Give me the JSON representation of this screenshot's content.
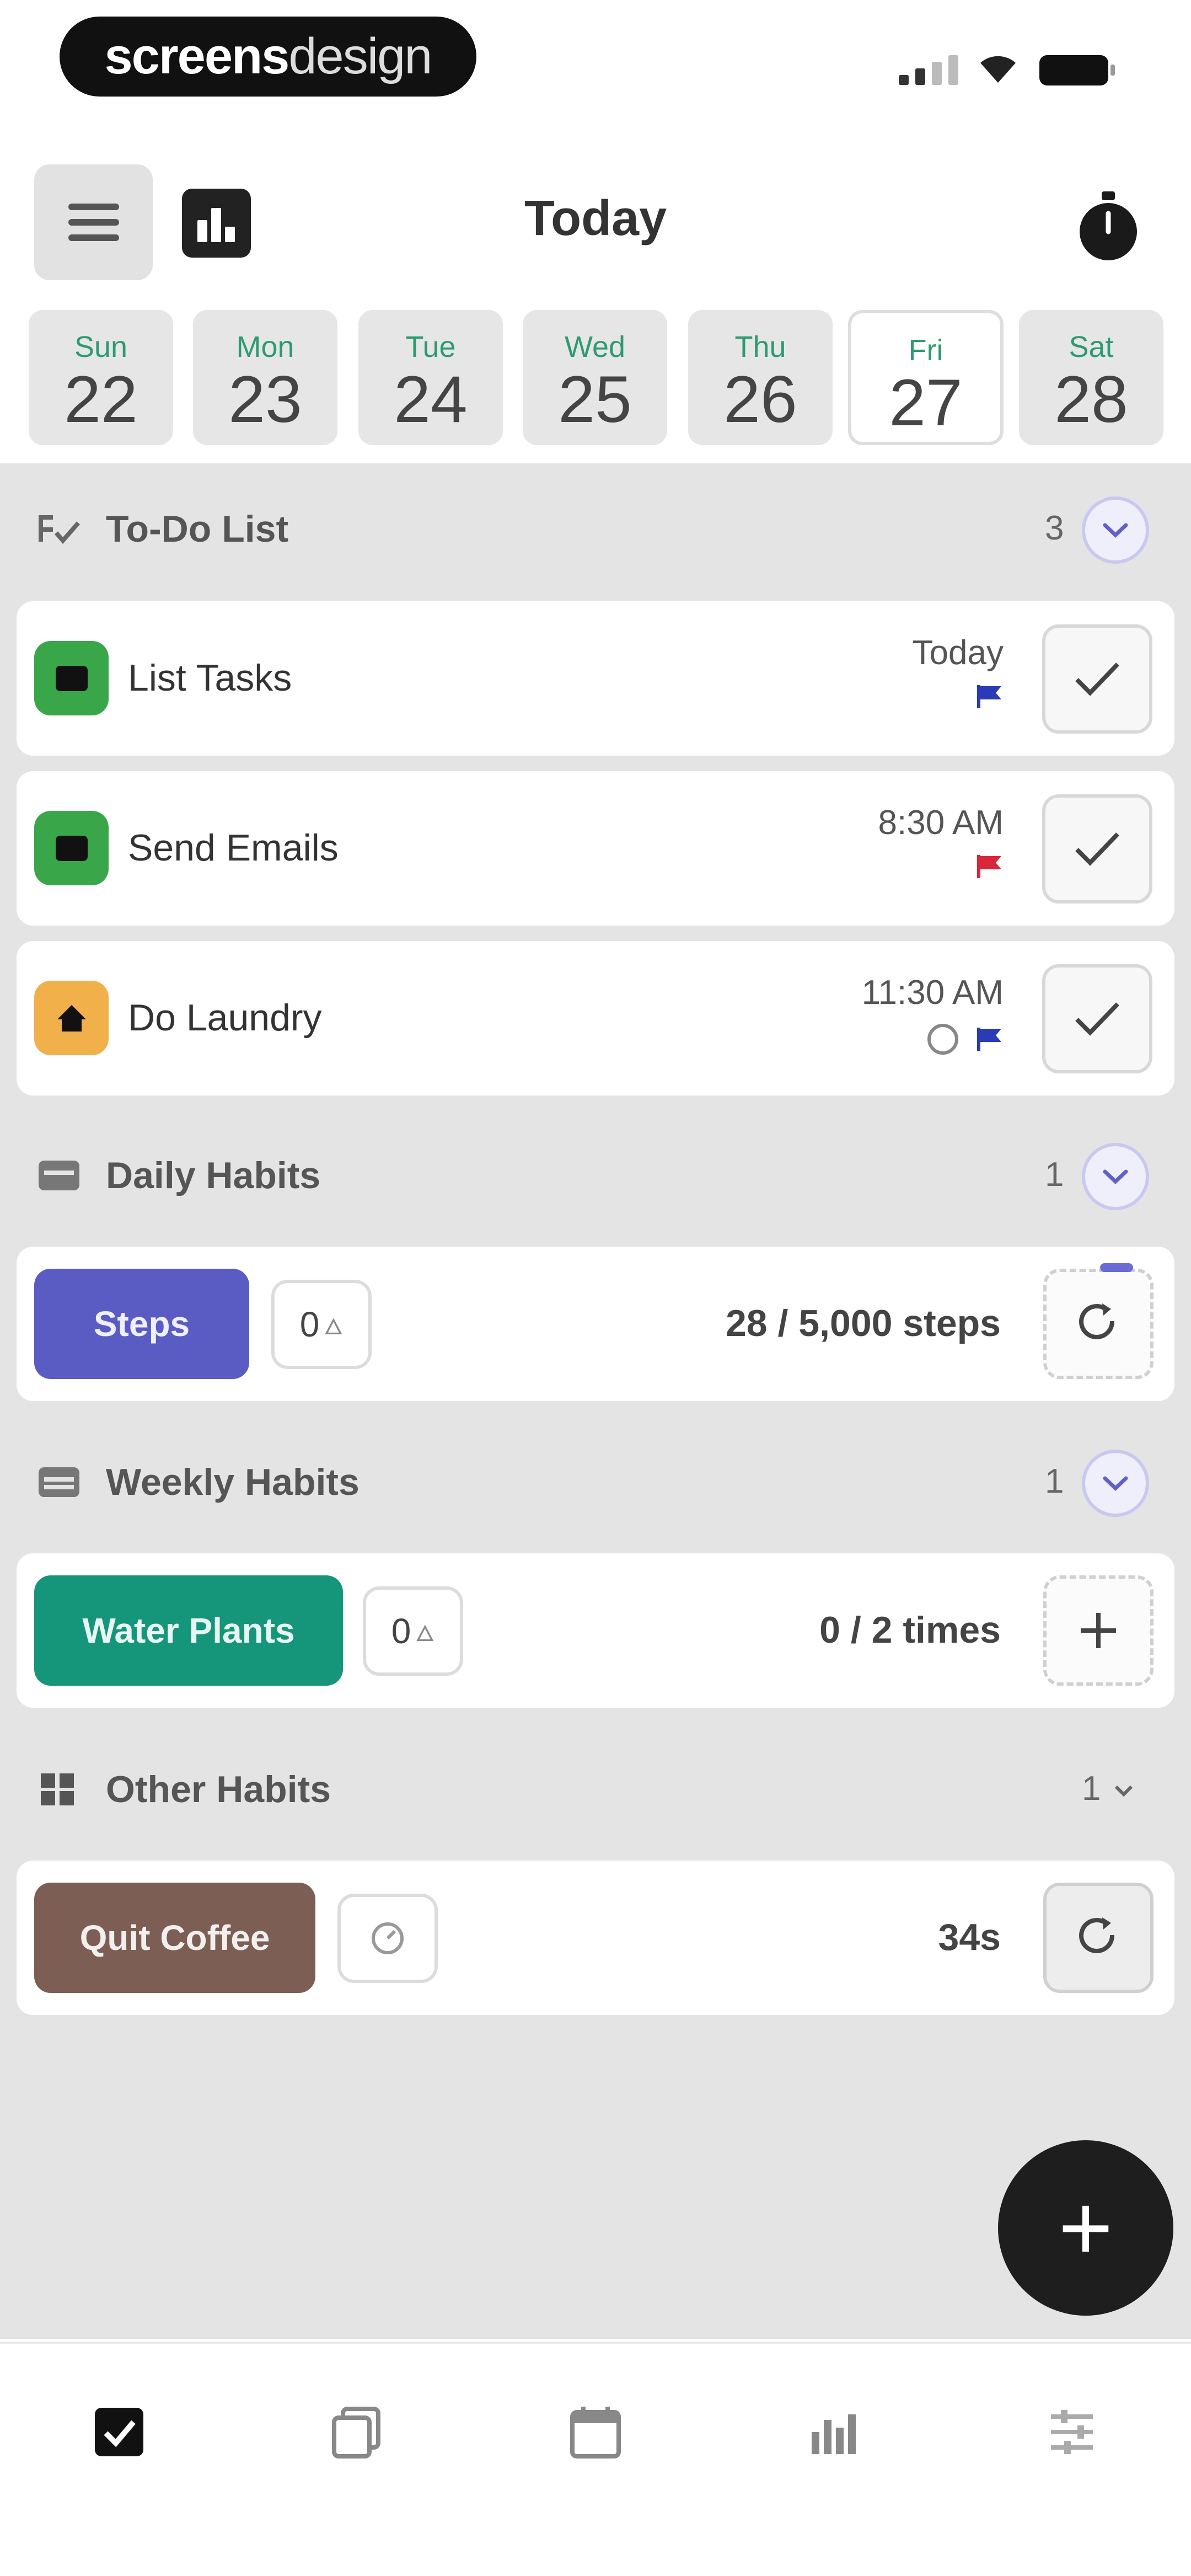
{
  "status_bar": {
    "brand_bold": "screens",
    "brand_light": "design"
  },
  "header": {
    "title": "Today",
    "menu_icon": "hamburger-icon",
    "stats_icon": "bar-chart-icon",
    "timer_icon": "stopwatch-icon"
  },
  "days": [
    {
      "name": "Sun",
      "num": "22"
    },
    {
      "name": "Mon",
      "num": "23"
    },
    {
      "name": "Tue",
      "num": "24"
    },
    {
      "name": "Wed",
      "num": "25"
    },
    {
      "name": "Thu",
      "num": "26"
    },
    {
      "name": "Fri",
      "num": "27",
      "selected": true
    },
    {
      "name": "Sat",
      "num": "28"
    }
  ],
  "todo": {
    "title": "To-Do List",
    "count": "3",
    "items": [
      {
        "title": "List Tasks",
        "time": "Today",
        "icon_color": "#3aa64a",
        "flag_color": "#2a3bb5",
        "icon": "briefcase-icon"
      },
      {
        "title": "Send Emails",
        "time": "8:30 AM",
        "icon_color": "#3aa64a",
        "flag_color": "#d9263a",
        "icon": "briefcase-icon"
      },
      {
        "title": "Do Laundry",
        "time": "11:30 AM",
        "icon_color": "#f2b04b",
        "flag_color": "#2a3bb5",
        "icon": "home-icon",
        "alarm": true
      }
    ]
  },
  "daily": {
    "title": "Daily Habits",
    "count": "1",
    "habit": {
      "name": "Steps",
      "streak": "0",
      "progress": "28 / 5,000 steps",
      "color": "#5b5bc4",
      "progress_fraction": 0.0056
    }
  },
  "weekly": {
    "title": "Weekly Habits",
    "count": "1",
    "habit": {
      "name": "Water Plants",
      "streak": "0",
      "progress": "0 / 2 times",
      "color": "#15957a"
    }
  },
  "other": {
    "title": "Other Habits",
    "count": "1",
    "habit": {
      "name": "Quit Coffee",
      "progress": "34s",
      "color": "#7d5e55"
    }
  },
  "fab": {
    "label": "+"
  },
  "tabs": [
    {
      "icon": "checkbox-icon",
      "active": true
    },
    {
      "icon": "journal-icon"
    },
    {
      "icon": "calendar-icon"
    },
    {
      "icon": "stats-icon"
    },
    {
      "icon": "settings-icon"
    }
  ]
}
